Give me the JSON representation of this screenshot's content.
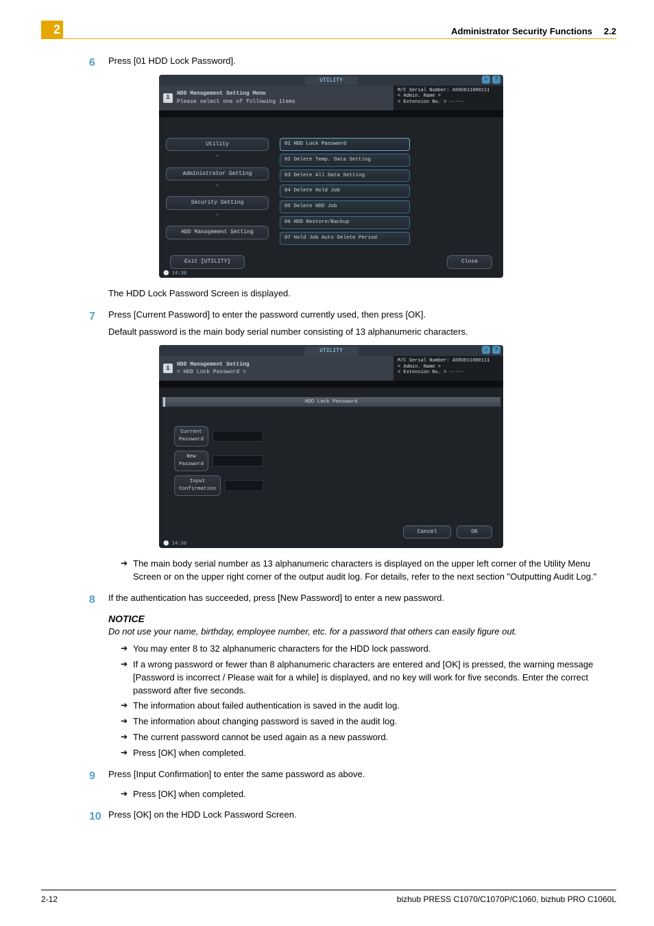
{
  "header": {
    "chapter": "2",
    "title": "Administrator Security Functions",
    "section": "2.2"
  },
  "steps": {
    "s6": {
      "num": "6",
      "text": "Press [01 HDD Lock Password]."
    },
    "caption1": "The HDD Lock Password Screen is displayed.",
    "s7": {
      "num": "7",
      "line1": "Press [Current Password] to enter the password currently used, then press [OK].",
      "line2": "Default password is the main body serial number consisting of 13 alphanumeric characters."
    },
    "bullet7": "The main body serial number as 13 alphanumeric characters is displayed on the upper left corner of the Utility Menu Screen or on the upper right corner of the output audit log. For details, refer to the next section \"Outputting Audit Log.\"",
    "s8": {
      "num": "8",
      "text": "If the authentication has succeeded, press [New Password] to enter a new password."
    },
    "notice_h": "NOTICE",
    "notice_body": "Do not use your name, birthday, employee number, etc. for a password that others can easily figure out.",
    "bullets8": [
      "You may enter 8 to 32 alphanumeric characters for the HDD lock password.",
      "If a wrong password or fewer than 8 alphanumeric characters are entered and [OK] is pressed, the warning message [Password is incorrect / Please wait for a while] is displayed, and no key will work for five seconds. Enter the correct password after five seconds.",
      "The information about failed authentication is saved in the audit log.",
      "The information about changing password is saved in the audit log.",
      "The current password cannot be used again as a new password.",
      "Press [OK] when completed."
    ],
    "s9": {
      "num": "9",
      "text": "Press [Input Confirmation] to enter the same password as above."
    },
    "bullets9": [
      "Press [OK] when completed."
    ],
    "s10": {
      "num": "10",
      "text": "Press [OK] on the HDD Lock Password Screen."
    }
  },
  "shot1": {
    "toptitle": "UTILITY",
    "info_l1": "HDD Management Setting Menu",
    "info_l2": "Please select one of following items",
    "serial": "M/C Serial Number: A50U011000111",
    "admin": "< Admin. Name >",
    "ext": "< Extension No. >  -----",
    "nav": [
      "Utility",
      "Administrator Setting",
      "Security Setting",
      "HDD Management Setting"
    ],
    "list": [
      "01 HDD Lock Password",
      "02 Delete Temp. Data Setting",
      "03 Delete All Data Setting",
      "04 Delete Hold Job",
      "05 Delete HDD Job",
      "06 HDD Restore/Backup",
      "07 Hold Job Auto Delete Period"
    ],
    "back": "Exit [UTILITY]",
    "close": "Close",
    "clock": "14:30"
  },
  "shot2": {
    "toptitle": "UTILITY",
    "info_l1": "HDD Management Setting",
    "info_l2": "< HDD Lock Password >",
    "serial": "M/C Serial Number: A50U011000111",
    "admin": "< Admin. Name >",
    "ext": "< Extension No. >  -----",
    "section": "HDD Lock Password",
    "pw": [
      "Current Password",
      "New Password",
      "Input Confirmation"
    ],
    "cancel": "Cancel",
    "ok": "OK",
    "clock": "14:30"
  },
  "footer": {
    "page": "2-12",
    "model": "bizhub PRESS C1070/C1070P/C1060, bizhub PRO C1060L"
  }
}
